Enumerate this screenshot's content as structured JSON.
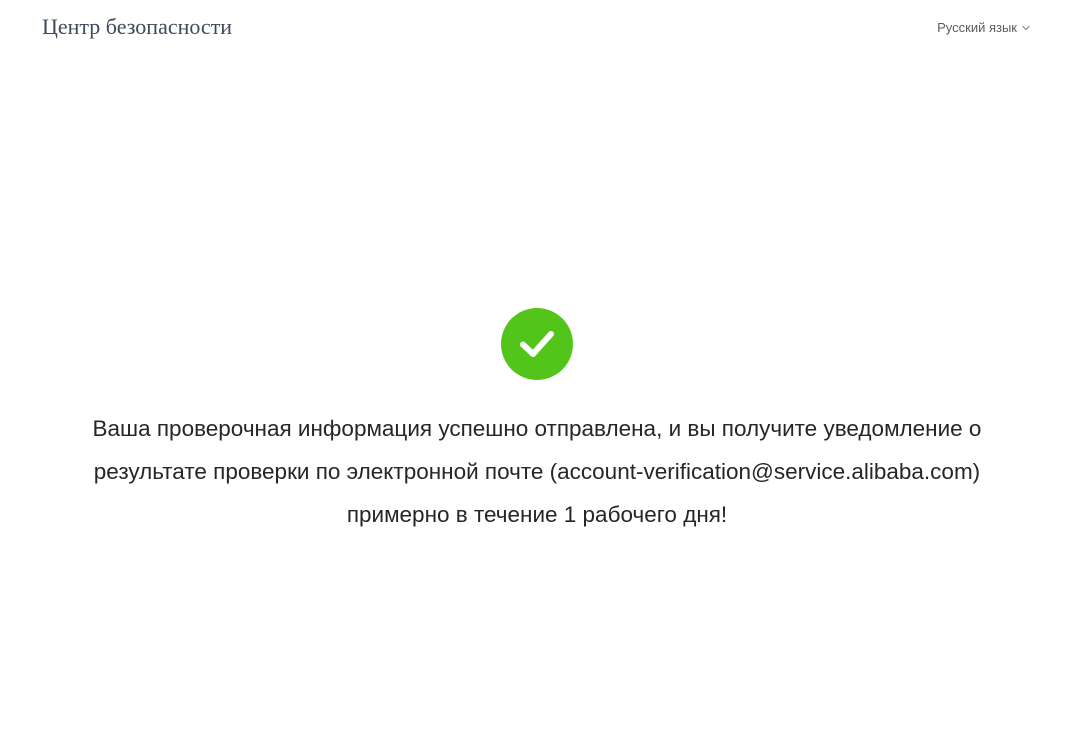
{
  "header": {
    "title": "Центр безопасности",
    "language_label": "Русский язык",
    "language_icon": "chevron-down-icon"
  },
  "status": {
    "icon": "success-check-icon",
    "icon_color": "#52c41a",
    "message": "Ваша проверочная информация успешно отправлена, и вы получите уведомление о результате проверки по электронной почте  (account-verification@service.alibaba.com) примерно в течение 1 рабочего дня!"
  }
}
